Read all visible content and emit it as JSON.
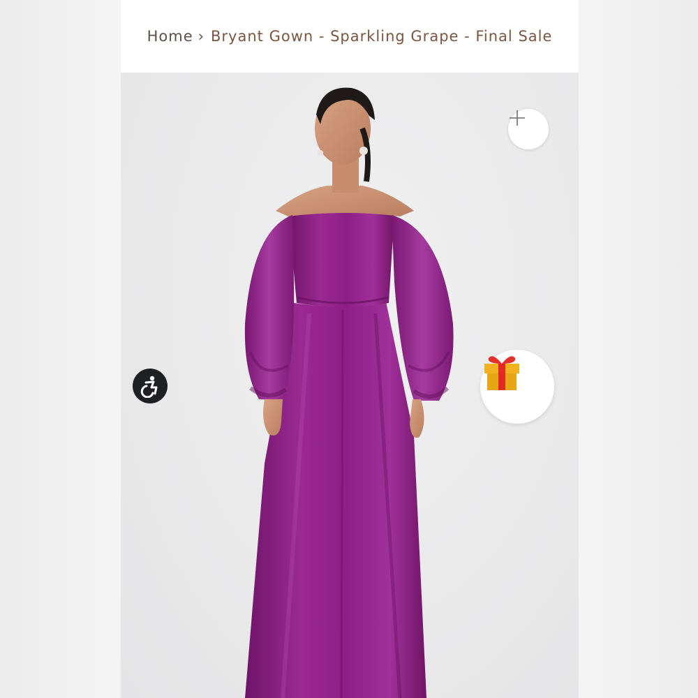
{
  "breadcrumb": {
    "home": "Home",
    "separator": "›",
    "current": "Bryant Gown - Sparkling Grape - Final Sale"
  },
  "product": {
    "dress_color": "#8e1f86"
  },
  "controls": {
    "zoom_icon": "plus-icon",
    "gift_icon": "gift-icon",
    "accessibility_icon": "accessibility-icon"
  }
}
